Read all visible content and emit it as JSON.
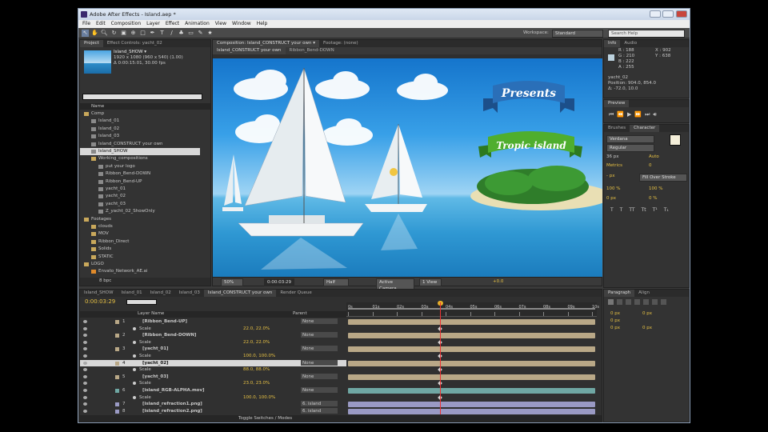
{
  "window": {
    "title": "Adobe After Effects - Island.aep *"
  },
  "menu": [
    "File",
    "Edit",
    "Composition",
    "Layer",
    "Effect",
    "Animation",
    "View",
    "Window",
    "Help"
  ],
  "workspace": {
    "label": "Workspace:",
    "value": "Standard"
  },
  "search": {
    "placeholder": "Search Help"
  },
  "project": {
    "tabs": [
      "Project",
      "Effect Controls: yacht_02"
    ],
    "thumb_name": "Island_SHOW ▾",
    "thumb_info1": "1920 x 1080 (960 x 540) (1.00)",
    "thumb_info2": "Δ 0:00:15:01, 30.00 fps",
    "name_header": "Name",
    "tree": [
      {
        "label": "Comp",
        "level": 0,
        "type": "folder"
      },
      {
        "label": "Island_01",
        "level": 1,
        "type": "comp"
      },
      {
        "label": "Island_02",
        "level": 1,
        "type": "comp"
      },
      {
        "label": "Island_03",
        "level": 1,
        "type": "comp"
      },
      {
        "label": "Island_CONSTRUCT your own",
        "level": 1,
        "type": "comp"
      },
      {
        "label": "Island_SHOW",
        "level": 1,
        "type": "comp",
        "selected": true
      },
      {
        "label": "Working_compositions",
        "level": 1,
        "type": "folder"
      },
      {
        "label": "put your logo",
        "level": 2,
        "type": "comp"
      },
      {
        "label": "Ribbon_Bend-DOWN",
        "level": 2,
        "type": "comp"
      },
      {
        "label": "Ribbon_Bend-UP",
        "level": 2,
        "type": "comp"
      },
      {
        "label": "yacht_01",
        "level": 2,
        "type": "comp"
      },
      {
        "label": "yacht_02",
        "level": 2,
        "type": "comp"
      },
      {
        "label": "yacht_03",
        "level": 2,
        "type": "comp"
      },
      {
        "label": "Z_yacht_02_ShowOnly",
        "level": 2,
        "type": "comp"
      },
      {
        "label": "Footages",
        "level": 0,
        "type": "folder"
      },
      {
        "label": "clouds",
        "level": 1,
        "type": "folder"
      },
      {
        "label": "MOV",
        "level": 1,
        "type": "folder"
      },
      {
        "label": "Ribbon_Direct",
        "level": 1,
        "type": "folder"
      },
      {
        "label": "Solids",
        "level": 1,
        "type": "folder"
      },
      {
        "label": "STATIC",
        "level": 1,
        "type": "folder"
      },
      {
        "label": "LOGO",
        "level": 0,
        "type": "folder"
      },
      {
        "label": "Envato_Network_AE.ai",
        "level": 1,
        "type": "file"
      }
    ],
    "bpc": "8 bpc"
  },
  "comp": {
    "tabs": [
      "Composition: Island_CONSTRUCT your own ▾",
      "Footage: (none)"
    ],
    "subtabs": [
      "Island_CONSTRUCT your own",
      "Ribbon_Bend-DOWN"
    ],
    "presents": "Presents",
    "tropic": "Tropic island",
    "zoom": "50%",
    "timecode": "0:00:03:29",
    "resolution": "Half",
    "camera": "Active Camera",
    "view": "1 View",
    "offset": "+0.0"
  },
  "info": {
    "tabs": [
      "Info",
      "Audio"
    ],
    "r": "R : 188",
    "g": "G : 210",
    "b": "B : 222",
    "a": "A : 255",
    "x": "X : 902",
    "y": "Y : 638",
    "layer": "yacht_02",
    "position": "Position: 904.0, 854.0",
    "delta": "Δ: -72.0, 10.0",
    "color": "#bcd2de"
  },
  "preview": {
    "tabs": [
      "Preview"
    ]
  },
  "character": {
    "tabs": [
      "Brushes",
      "Character"
    ],
    "font": "Verdana",
    "style": "Regular",
    "size": "36 px",
    "leading": "Auto",
    "kerning": "Metrics",
    "tracking": "0",
    "stroke": "- px",
    "stroke_mode": "Fill Over Stroke",
    "vscale": "100 %",
    "hscale": "100 %",
    "baseline": "0 px",
    "tsume": "0 %",
    "styles": [
      "T",
      "T",
      "TT",
      "Tt",
      "T¹",
      "T₁"
    ]
  },
  "paragraph": {
    "tabs": [
      "Paragraph",
      "Align"
    ],
    "indent_left": "0 px",
    "indent_right": "0 px",
    "indent_first": "0 px",
    "space_before": "0 px",
    "space_after": "0 px"
  },
  "timeline": {
    "tabs": [
      "Island_SHOW",
      "Island_01",
      "Island_02",
      "Island_03",
      "Island_CONSTRUCT your own",
      "Render Queue"
    ],
    "active_tab": 4,
    "time": "0:00:03:29",
    "header_layer": "Layer Name",
    "header_parent": "Parent",
    "ruler": [
      "0s",
      "01s",
      "02s",
      "03s",
      "04s",
      "05s",
      "06s",
      "07s",
      "08s",
      "09s",
      "10s"
    ],
    "playhead_fraction": 0.378,
    "layers": [
      {
        "num": "1",
        "name": "[Ribbon_Bend-UP]",
        "parent": "None",
        "color": "#b9a887",
        "kind": "layer"
      },
      {
        "name": "Scale",
        "value": "22.0, 22.0%",
        "kind": "prop",
        "color": "#b9a887"
      },
      {
        "num": "2",
        "name": "[Ribbon_Bend-DOWN]",
        "parent": "None",
        "color": "#b9a887",
        "kind": "layer"
      },
      {
        "name": "Scale",
        "value": "22.0, 22.0%",
        "kind": "prop",
        "color": "#b9a887"
      },
      {
        "num": "3",
        "name": "[yacht_01]",
        "parent": "None",
        "color": "#b9a887",
        "kind": "layer"
      },
      {
        "name": "Scale",
        "value": "100.0, 100.0%",
        "kind": "prop",
        "color": "#b9a887"
      },
      {
        "num": "4",
        "name": "[yacht_02]",
        "parent": "None",
        "color": "#b9a887",
        "kind": "layer",
        "selected": true
      },
      {
        "name": "Scale",
        "value": "88.0, 88.0%",
        "kind": "prop",
        "color": "#b9a887"
      },
      {
        "num": "5",
        "name": "[yacht_03]",
        "parent": "None",
        "color": "#b9a887",
        "kind": "layer"
      },
      {
        "name": "Scale",
        "value": "23.0, 23.0%",
        "kind": "prop",
        "color": "#b9a887"
      },
      {
        "num": "6",
        "name": "[island_RGB-ALPHA.mov]",
        "parent": "None",
        "color": "#6fa7a3",
        "kind": "layer"
      },
      {
        "name": "Scale",
        "value": "100.0, 100.0%",
        "kind": "prop",
        "color": "#6fa7a3"
      },
      {
        "num": "7",
        "name": "[island_refraction1.png]",
        "parent": "6. island",
        "color": "#9a9ac4",
        "kind": "layer"
      },
      {
        "num": "8",
        "name": "[island_refraction2.png]",
        "parent": "6. island",
        "color": "#9a9ac4",
        "kind": "layer"
      }
    ],
    "toggle": "Toggle Switches / Modes"
  }
}
